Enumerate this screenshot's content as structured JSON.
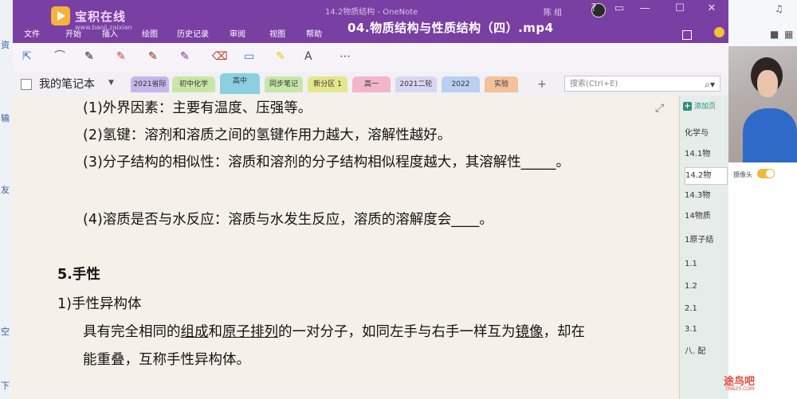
{
  "outer_sidebar": {
    "items": [
      "资",
      "输",
      "友",
      "空",
      "下"
    ]
  },
  "title_bar": {
    "brand_name": "宝积在线",
    "brand_sub": "www.baoji.zaixian",
    "document_title": "14.2物质结构 - OneNote",
    "user_name": "陈 组",
    "video_title": "04.物质结构与性质结构（四）.mp4",
    "menu": [
      "文件",
      "开始",
      "插入",
      "绘图",
      "历史记录",
      "审阅",
      "视图",
      "帮助"
    ],
    "window_controls": [
      "?",
      "▭",
      "—",
      "☐",
      "✕"
    ]
  },
  "toolbar": {
    "tools": [
      {
        "icon": "cursor-icon",
        "glyph": "⇱",
        "color": "#3b6fc7"
      },
      {
        "icon": "lasso-icon",
        "glyph": "⌒",
        "color": "#555555"
      },
      {
        "icon": "pen-black-icon",
        "glyph": "✎",
        "color": "#111111"
      },
      {
        "icon": "pen-red-icon",
        "glyph": "✎",
        "color": "#d23b2f"
      },
      {
        "icon": "pen-dark-red-icon",
        "glyph": "✎",
        "color": "#8b1a1a"
      },
      {
        "icon": "pen-purple-icon",
        "glyph": "✎",
        "color": "#7a2fa8"
      },
      {
        "icon": "eraser-icon",
        "glyph": "⌫",
        "color": "#c0392b"
      },
      {
        "icon": "shapes-icon",
        "glyph": "▭",
        "color": "#3b6fc7"
      },
      {
        "icon": "highlighter-icon",
        "glyph": "✎",
        "color": "#e9c600"
      },
      {
        "icon": "ink-to-text-icon",
        "glyph": "A",
        "color": "#444444"
      },
      {
        "icon": "more-tools-icon",
        "glyph": "⋯",
        "color": "#444444"
      }
    ]
  },
  "notebook": {
    "name": "我的笔记本",
    "tabs": [
      {
        "label": "2021省际",
        "color": "#c6b6ea"
      },
      {
        "label": "初中化学",
        "color": "#c9e6a7"
      },
      {
        "label": "高中",
        "color": "#8ad0df"
      },
      {
        "label": "同步笔记",
        "color": "#c7e6a9"
      },
      {
        "label": "新分区 1",
        "color": "#e6e68d"
      },
      {
        "label": "高一",
        "color": "#f2b6cb"
      },
      {
        "label": "2021二轮",
        "color": "#d9d6f2"
      },
      {
        "label": "2022",
        "color": "#b9d0f2"
      },
      {
        "label": "实验",
        "color": "#f3c29a"
      }
    ],
    "add_tab": "+",
    "search_placeholder": "搜索(Ctrl+E)"
  },
  "page_content": {
    "l1": "(1)外界因素：主要有温度、压强等。",
    "l2": "(2)氢键：溶剂和溶质之间的氢键作用力越大，溶解性越好。",
    "l3": "(3)分子结构的相似性：溶质和溶剂的分子结构相似程度越大，其溶解性_____。",
    "l4": "(4)溶质是否与水反应：溶质与水发生反应，溶质的溶解度会____。",
    "heading": "5.手性",
    "l5": "1)手性异构体",
    "l6a": "具有完全相同的",
    "l6b": "组成",
    "l6c": "和",
    "l6d": "原子排列",
    "l6e": "的一对分子，如同左手与右手一样互为",
    "l6f": "镜像",
    "l6g": "，却在",
    "l7": "能重叠，互称手性异构体。"
  },
  "page_list": {
    "add_page": "添加页",
    "pages": [
      "化学与",
      "14.1物",
      "14.2物",
      "14.3物",
      "14物质",
      "1原子结",
      "1.1",
      "1.2",
      "2.1",
      "3.1",
      "八. 配"
    ],
    "selected_index": 2
  },
  "webcam_panel": {
    "toggle_label": "摄像头"
  },
  "watermark": {
    "text": "途鸟吧",
    "sub": "TNBZS.COM"
  }
}
